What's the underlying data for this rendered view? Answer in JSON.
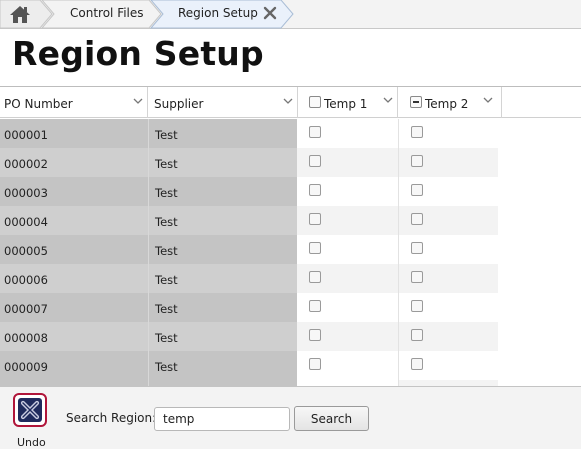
{
  "breadcrumb": {
    "home_icon": "home-icon",
    "items": [
      {
        "label": "Control Files"
      },
      {
        "label": "Region Setup",
        "close_icon": "close-icon"
      }
    ]
  },
  "page": {
    "title": "Region Setup"
  },
  "grid": {
    "columns": [
      {
        "label": "PO Number",
        "icon": "chevron-down-icon"
      },
      {
        "label": "Supplier",
        "icon": "chevron-down-icon"
      },
      {
        "label": "Temp 1",
        "icon": "chevron-down-icon",
        "header_checkbox": "unchecked"
      },
      {
        "label": "Temp 2",
        "icon": "chevron-down-icon",
        "header_checkbox": "indeterminate"
      }
    ],
    "rows": [
      {
        "po": "000001",
        "supplier": "Test",
        "temp1": false,
        "temp2": false
      },
      {
        "po": "000002",
        "supplier": "Test",
        "temp1": false,
        "temp2": false
      },
      {
        "po": "000003",
        "supplier": "Test",
        "temp1": false,
        "temp2": false
      },
      {
        "po": "000004",
        "supplier": "Test",
        "temp1": false,
        "temp2": false
      },
      {
        "po": "000005",
        "supplier": "Test",
        "temp1": false,
        "temp2": false
      },
      {
        "po": "000006",
        "supplier": "Test",
        "temp1": false,
        "temp2": false
      },
      {
        "po": "000007",
        "supplier": "Test",
        "temp1": false,
        "temp2": false
      },
      {
        "po": "000008",
        "supplier": "Test",
        "temp1": false,
        "temp2": false
      },
      {
        "po": "000009",
        "supplier": "Test",
        "temp1": false,
        "temp2": false
      }
    ]
  },
  "footer": {
    "undo_label": "Undo",
    "undo_icon": "undo-x-icon",
    "search_label": "Search Region:",
    "search_value": "temp",
    "search_button": "Search"
  },
  "colors": {
    "readonly_cell_dark": "#c4c4c4",
    "readonly_cell_light": "#cfcfcf",
    "editable_row_alt": "#f3f3f3",
    "undo_border": "#b0153a",
    "undo_icon": "#1f2a5c"
  }
}
